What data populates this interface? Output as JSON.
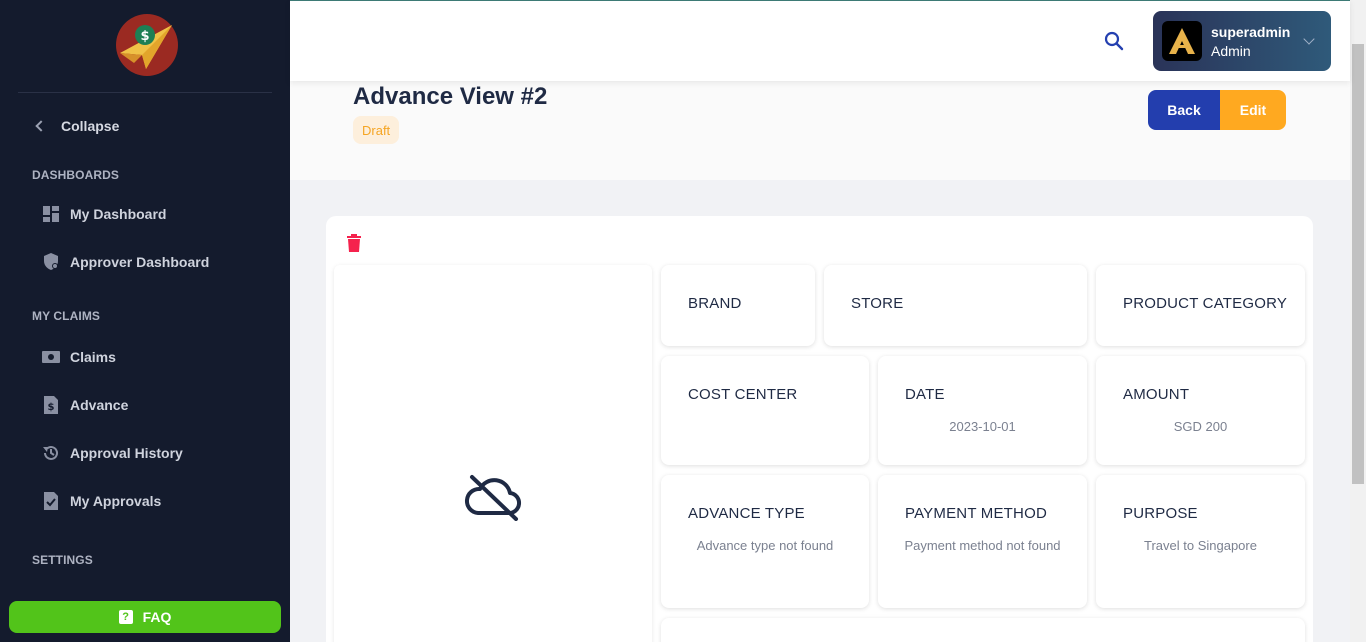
{
  "sidebar": {
    "collapse_label": "Collapse",
    "sections": {
      "dashboards": "DASHBOARDS",
      "my_claims": "MY CLAIMS",
      "settings": "SETTINGS"
    },
    "items": {
      "my_dashboard": "My Dashboard",
      "approver_dashboard": "Approver Dashboard",
      "claims": "Claims",
      "advance": "Advance",
      "approval_history": "Approval History",
      "my_approvals": "My Approvals"
    },
    "faq_label": "FAQ"
  },
  "topbar": {
    "user_name": "superadmin",
    "user_role": "Admin"
  },
  "header": {
    "title": "Advance View #2",
    "status": "Draft",
    "back_label": "Back",
    "edit_label": "Edit"
  },
  "fields": {
    "brand": {
      "label": "BRAND",
      "value": ""
    },
    "store": {
      "label": "STORE",
      "value": ""
    },
    "product_category": {
      "label": "PRODUCT CATEGORY",
      "value": ""
    },
    "cost_center": {
      "label": "COST CENTER",
      "value": ""
    },
    "date": {
      "label": "DATE",
      "value": "2023-10-01"
    },
    "amount": {
      "label": "AMOUNT",
      "value": "SGD 200"
    },
    "advance_type": {
      "label": "ADVANCE TYPE",
      "value": "Advance type not found"
    },
    "payment_method": {
      "label": "PAYMENT METHOD",
      "value": "Payment method not found"
    },
    "purpose": {
      "label": "PURPOSE",
      "value": "Travel to Singapore"
    }
  },
  "colors": {
    "sidebar_bg": "#141b2d",
    "primary": "#233eae",
    "warning": "#ffa920",
    "success": "#52c41a",
    "danger": "#f5224d"
  }
}
